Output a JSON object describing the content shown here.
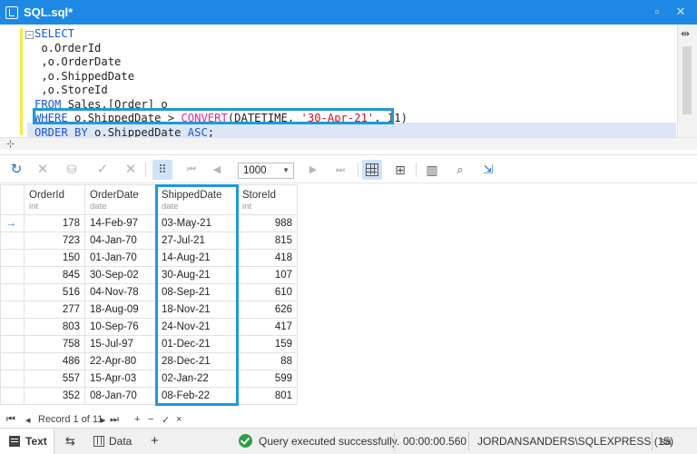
{
  "window": {
    "title": "SQL.sql*"
  },
  "sql": {
    "lines": [
      {
        "parts": [
          {
            "c": "kw",
            "t": "SELECT"
          }
        ]
      },
      {
        "parts": [
          {
            "c": "txt",
            "t": " o.OrderId"
          }
        ]
      },
      {
        "parts": [
          {
            "c": "txt",
            "t": " ,o.OrderDate"
          }
        ]
      },
      {
        "parts": [
          {
            "c": "txt",
            "t": " ,o.ShippedDate"
          }
        ]
      },
      {
        "parts": [
          {
            "c": "txt",
            "t": " ,o.StoreId"
          }
        ]
      },
      {
        "parts": [
          {
            "c": "kw",
            "t": "FROM"
          },
          {
            "c": "txt",
            "t": " Sales.[Order] o"
          }
        ]
      },
      {
        "parts": [
          {
            "c": "kw",
            "t": "WHERE"
          },
          {
            "c": "txt",
            "t": " o.ShippedDate > "
          },
          {
            "c": "fn",
            "t": "CONVERT"
          },
          {
            "c": "txt",
            "t": "(DATETIME, "
          },
          {
            "c": "str",
            "t": "'30-Apr-21'"
          },
          {
            "c": "txt",
            "t": ", 11)"
          }
        ]
      },
      {
        "parts": [
          {
            "c": "kw",
            "t": "ORDER BY"
          },
          {
            "c": "txt",
            "t": " o.ShippedDate "
          },
          {
            "c": "kw",
            "t": "ASC"
          },
          {
            "c": "txt",
            "t": ";"
          }
        ]
      }
    ]
  },
  "toolbar": {
    "page_size": "1000"
  },
  "grid": {
    "columns": [
      {
        "name": "OrderId",
        "type": "int"
      },
      {
        "name": "OrderDate",
        "type": "date"
      },
      {
        "name": "ShippedDate",
        "type": "date"
      },
      {
        "name": "StoreId",
        "type": "int"
      }
    ],
    "rows": [
      [
        "178",
        "14-Feb-97",
        "03-May-21",
        "988"
      ],
      [
        "723",
        "04-Jan-70",
        "27-Jul-21",
        "815"
      ],
      [
        "150",
        "01-Jan-70",
        "14-Aug-21",
        "418"
      ],
      [
        "845",
        "30-Sep-02",
        "30-Aug-21",
        "107"
      ],
      [
        "516",
        "04-Nov-78",
        "08-Sep-21",
        "610"
      ],
      [
        "277",
        "18-Aug-09",
        "18-Nov-21",
        "626"
      ],
      [
        "803",
        "10-Sep-76",
        "24-Nov-21",
        "417"
      ],
      [
        "758",
        "15-Jul-97",
        "01-Dec-21",
        "159"
      ],
      [
        "486",
        "22-Apr-80",
        "28-Dec-21",
        "88"
      ],
      [
        "557",
        "15-Apr-03",
        "02-Jan-22",
        "599"
      ],
      [
        "352",
        "08-Jan-70",
        "08-Feb-22",
        "801"
      ]
    ],
    "current_row_marker": "→"
  },
  "navigator": {
    "first": "⏮",
    "prev": "◂",
    "record_text": "Record 1 of 11",
    "next": "▸",
    "last": "⏭",
    "add": "+",
    "remove": "−",
    "accept": "✓",
    "cancel": "×"
  },
  "status": {
    "tab_text": "Text",
    "tab_data": "Data",
    "add_tab": "+",
    "message": "Query executed successfully.",
    "elapsed": "00:00:00.560",
    "server": "JORDANSANDERS\\SQLEXPRESS (15)",
    "user": "sa"
  }
}
